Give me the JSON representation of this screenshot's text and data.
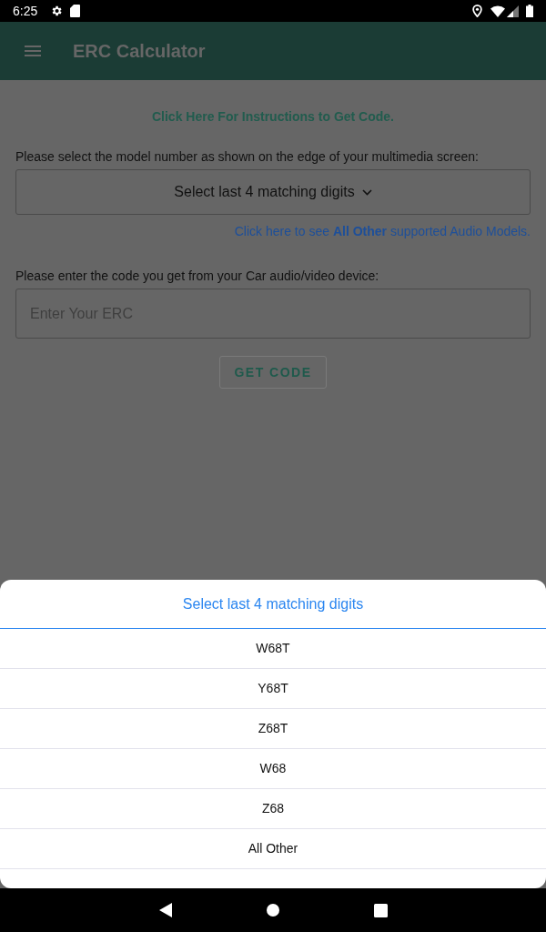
{
  "status_bar": {
    "time": "6:25"
  },
  "app_bar": {
    "title": "ERC Calculator"
  },
  "form": {
    "instructions_link": "Click Here For Instructions to Get Code.",
    "model_label": "Please select the model number as shown on the edge of your multimedia screen:",
    "model_dropdown": {
      "value": "Select last 4 matching digits"
    },
    "all_other_link": "Click here to see **All Other** supported Audio Models.",
    "code_label": "Please enter the code you get from your Car audio/video device:",
    "code_field": {
      "placeholder": "Enter Your ERC"
    },
    "get_code_button": "GET CODE"
  },
  "picker_sheet": {
    "title": "Select last 4 matching digits",
    "options": [
      {
        "label": "W68T"
      },
      {
        "label": "Y68T"
      },
      {
        "label": "Z68T"
      },
      {
        "label": "W68"
      },
      {
        "label": "Z68"
      },
      {
        "label": "All Other"
      }
    ]
  }
}
